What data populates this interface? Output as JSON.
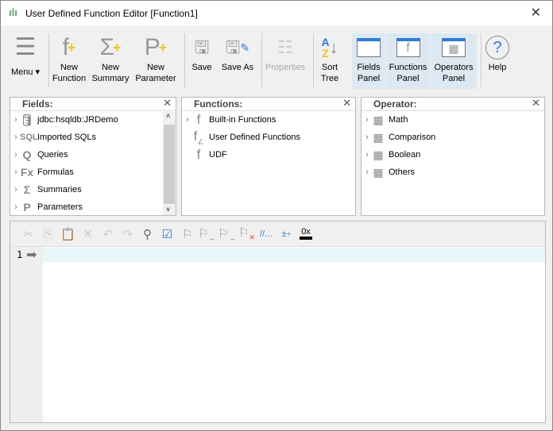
{
  "window": {
    "title": "User Defined Function Editor [Function1]",
    "close": "✕"
  },
  "toolbar": {
    "menu": "Menu ▾",
    "new_function": [
      "New",
      "Function"
    ],
    "new_summary": [
      "New",
      "Summary"
    ],
    "new_parameter": [
      "New",
      "Parameter"
    ],
    "save": "Save",
    "save_as": "Save As",
    "properties": "Properties",
    "sort_tree": [
      "Sort",
      "Tree"
    ],
    "fields_panel": [
      "Fields",
      "Panel"
    ],
    "functions_panel": [
      "Functions",
      "Panel"
    ],
    "operators_panel": [
      "Operators",
      "Panel"
    ],
    "help": "Help"
  },
  "fields": {
    "title": "Fields:",
    "items": [
      "jdbc:hsqldb:JRDemo",
      "Imported SQLs",
      "Queries",
      "Formulas",
      "Summaries",
      "Parameters"
    ]
  },
  "functions": {
    "title": "Functions:",
    "items": [
      "Built-in Functions",
      "User Defined Functions",
      "UDF"
    ]
  },
  "operator": {
    "title": "Operator:",
    "items": [
      "Math",
      "Comparison",
      "Boolean",
      "Others"
    ]
  },
  "editor": {
    "line_number": "1",
    "hex_label": "0x"
  },
  "colors": {
    "selected_panel": "#dce8f2",
    "current_line": "#e8f7f9",
    "accent_plus": "#f5c518"
  }
}
